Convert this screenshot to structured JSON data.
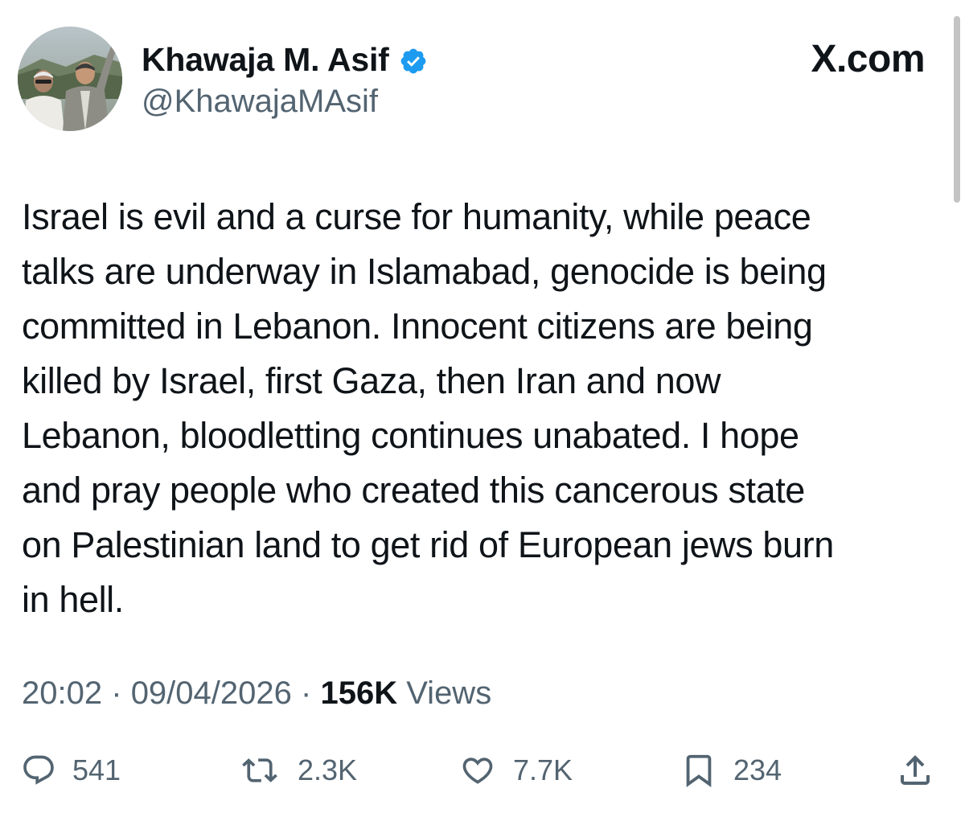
{
  "author": {
    "display_name": "Khawaja M. Asif",
    "handle": "@KhawajaMAsif",
    "verified": true,
    "avatar_icon": "profile-photo"
  },
  "brand": {
    "logo_text": "X.com"
  },
  "tweet": {
    "text": "Israel is evil and a curse for humanity, while peace\ntalks are underway in Islamabad, genocide is being\ncommitted in Lebanon. Innocent citizens are being\nkilled by Israel, first Gaza, then Iran and now\nLebanon, bloodletting continues unabated. I hope\nand pray people who created this cancerous state\non Palestinian land to get rid of European jews burn\nin hell.",
    "time": "20:02",
    "separator": "·",
    "date": "09/04/2026",
    "views_count": "156K",
    "views_label": "Views"
  },
  "actions": {
    "replies": "541",
    "reposts": "2.3K",
    "likes": "7.7K",
    "bookmarks": "234"
  },
  "colors": {
    "text": "#0f1419",
    "secondary": "#536471",
    "verified_blue": "#1d9bf0",
    "background": "#ffffff"
  }
}
